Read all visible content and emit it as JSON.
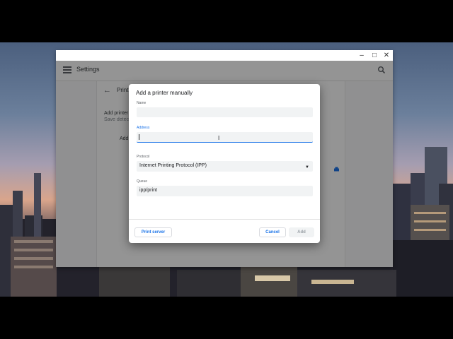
{
  "window": {
    "controls": {
      "minimize": "–",
      "maximize": "□",
      "close": "✕"
    }
  },
  "app": {
    "title": "Settings",
    "icons": [
      "menu-icon",
      "search-icon"
    ]
  },
  "background_page": {
    "heading": "Print",
    "add_printer_line": "Add printer",
    "save_detected_line": "Save detect",
    "add_label": "Add"
  },
  "dialog": {
    "title": "Add a printer manually",
    "name": {
      "label": "Name",
      "value": "",
      "placeholder": ""
    },
    "address": {
      "label": "Address",
      "value": "",
      "placeholder": ""
    },
    "protocol": {
      "label": "Protocol",
      "selected": "Internet Printing Protocol (IPP)"
    },
    "queue": {
      "label": "Queue",
      "value": "ipp/print"
    },
    "buttons": {
      "print_server": "Print server",
      "cancel": "Cancel",
      "add": "Add"
    }
  },
  "colors": {
    "accent": "#1a73e8",
    "disabled": "#9aa0a6"
  }
}
